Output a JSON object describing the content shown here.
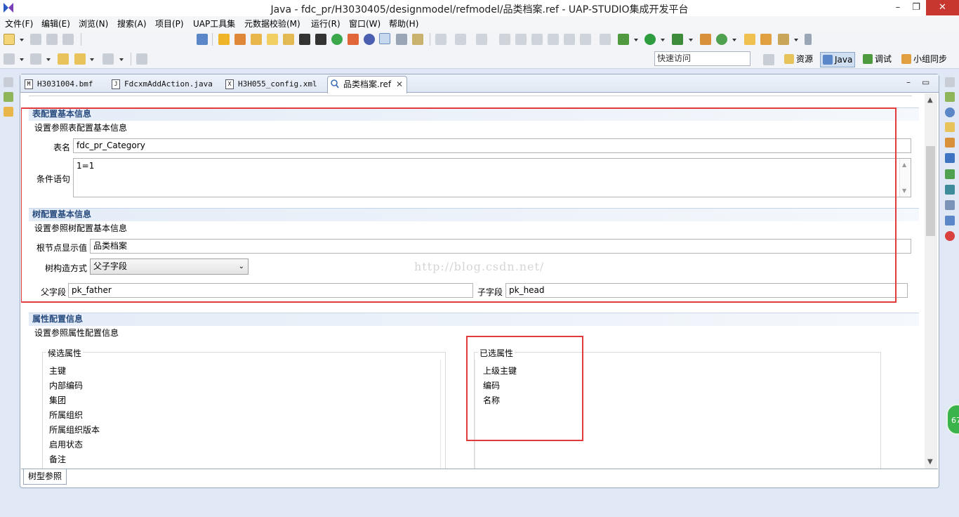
{
  "window": {
    "title": "Java - fdc_pr/H3030405/designmodel/refmodel/品类档案.ref - UAP-STUDIO集成开发平台",
    "minimize": "–",
    "restore": "❐",
    "close": "✕"
  },
  "menu": [
    "文件(F)",
    "编辑(E)",
    "浏览(N)",
    "搜索(A)",
    "项目(P)",
    "UAP工具集",
    "元数据校验(M)",
    "运行(R)",
    "窗口(W)",
    "帮助(H)"
  ],
  "quick_access": {
    "placeholder": "快速访问"
  },
  "perspectives": {
    "resource": "资源",
    "java": "Java",
    "debug": "调试",
    "team": "小组同步"
  },
  "tabs": [
    {
      "label": "H3031004.bmf",
      "icon": "M"
    },
    {
      "label": "FdcxmAddAction.java",
      "icon": "J"
    },
    {
      "label": "H3H055_config.xml",
      "icon": "X"
    },
    {
      "label": "品类档案.ref",
      "close": "✕"
    }
  ],
  "editor_controls": {
    "minimize": "–",
    "maximize": "▭"
  },
  "table_config": {
    "header": "表配置基本信息",
    "desc": "设置参照表配置基本信息",
    "table_name_label": "表名",
    "table_name_value": "fdc_pr_Category",
    "condition_label": "条件语句",
    "condition_value": "1=1"
  },
  "tree_config": {
    "header": "树配置基本信息",
    "desc": "设置参照树配置基本信息",
    "root_label": "根节点显示值",
    "root_value": "品类档案",
    "build_label": "树构造方式",
    "build_value": "父子字段",
    "parent_label": "父字段",
    "parent_value": "pk_father",
    "child_label": "子字段",
    "child_value": "pk_head"
  },
  "watermark": "http://blog.csdn.net/",
  "attr_config": {
    "header": "属性配置信息",
    "desc": "设置参照属性配置信息",
    "candidate_title": "候选属性",
    "candidates": [
      "主键",
      "内部编码",
      "集团",
      "所属组织",
      "所属组织版本",
      "启用状态",
      "备注"
    ],
    "selected_title": "已选属性",
    "selected": [
      "上级主键",
      "编码",
      "名称"
    ]
  },
  "bottom_tab": "树型参照",
  "side_badge": "67",
  "colors": {
    "highlight_box": "#e23b3b",
    "section_header_text": "#2a4d80",
    "close_button": "#c7372f"
  }
}
